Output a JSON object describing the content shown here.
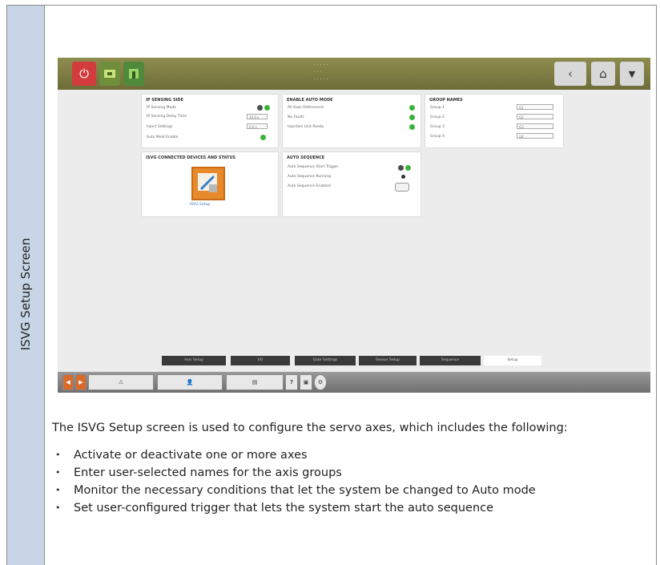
{
  "sidebar": {
    "title": "ISVG Setup Screen"
  },
  "screenshot": {
    "topbar": {
      "info_lines": [
        "· · · · ·",
        "· · ·",
        "· · · · ·"
      ],
      "nav": {
        "back": "‹",
        "home": "⌂",
        "down": "▼"
      }
    },
    "cards": {
      "ip_sensing": {
        "title": "IP SENSING SIDE",
        "rows": [
          "IP Sensing Mode",
          "IP Sensing Delay Time",
          "Inject Settings",
          "Auto Mold Enable"
        ],
        "fields": [
          "10.0 s",
          "0.0 s"
        ]
      },
      "enable_auto_mode": {
        "title": "ENABLE AUTO MODE",
        "rows": [
          "All Axes Referenced",
          "No Faults",
          "Injection Unit Ready"
        ]
      },
      "group_names": {
        "title": "GROUP NAMES",
        "rows": [
          "Group 1",
          "Group 2",
          "Group 3",
          "Group 4"
        ],
        "fields": [
          "G1",
          "G2",
          "G3",
          "G4"
        ]
      },
      "axis_connected": {
        "title": "ISVG CONNECTED DEVICES AND STATUS",
        "caption": "ISVG Setup"
      },
      "auto_sequence": {
        "title": "AUTO SEQUENCE",
        "rows": [
          "Auto Sequence Start Trigger",
          "Auto Sequence Running",
          "Auto Sequence Enabled"
        ]
      }
    },
    "bottom_tabs": [
      "Axis Setup",
      "I/O",
      "Gate Settings",
      "Sensor Setup",
      "Sequence",
      "Setup"
    ],
    "statusbar": {
      "help": "?"
    }
  },
  "description": {
    "intro": "The ISVG Setup screen is used to configure the servo axes, which includes the following:",
    "bullets": [
      "Activate or deactivate one or more axes",
      "Enter user-selected names for the axis groups",
      "Monitor the necessary conditions that let the system be changed to Auto mode",
      "Set user-configured trigger that lets the system start the auto sequence"
    ]
  }
}
